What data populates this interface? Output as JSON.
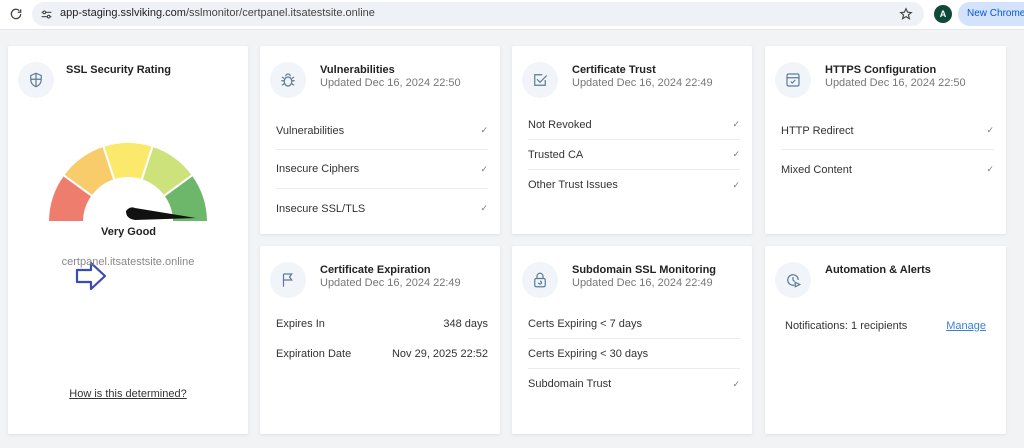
{
  "browser": {
    "url_host": "app-staging.sslviking.com",
    "url_path": "/sslmonitor/certpanel.itsatestsite.online",
    "avatar_initial": "A",
    "new_chrome_label": "New Chrome a"
  },
  "rating": {
    "title": "SSL Security Rating",
    "grade": "Very Good",
    "domain": "certpanel.itsatestsite.online",
    "how_link": "How is this determined?",
    "gauge_colors": [
      "#ef7d6d",
      "#f8cc6b",
      "#fbe96b",
      "#cde27a",
      "#6db76b"
    ],
    "arrow_color": "#3a4bb3"
  },
  "vulnerabilities": {
    "title": "Vulnerabilities",
    "updated": "Updated Dec 16, 2024 22:50",
    "rows": [
      {
        "label": "Vulnerabilities",
        "status": "✓"
      },
      {
        "label": "Insecure Ciphers",
        "status": "✓"
      },
      {
        "label": "Insecure SSL/TLS",
        "status": "✓"
      }
    ]
  },
  "trust": {
    "title": "Certificate Trust",
    "updated": "Updated Dec 16, 2024 22:49",
    "rows": [
      {
        "label": "Not Revoked",
        "status": "✓"
      },
      {
        "label": "Trusted CA",
        "status": "✓"
      },
      {
        "label": "Other Trust Issues",
        "status": "✓"
      }
    ]
  },
  "https": {
    "title": "HTTPS Configuration",
    "updated": "Updated Dec 16, 2024 22:50",
    "rows": [
      {
        "label": "HTTP Redirect",
        "status": "✓"
      },
      {
        "label": "Mixed Content",
        "status": "✓"
      }
    ]
  },
  "expiration": {
    "title": "Certificate Expiration",
    "updated": "Updated Dec 16, 2024 22:49",
    "rows": [
      {
        "label": "Expires In",
        "value": "348 days"
      },
      {
        "label": "Expiration Date",
        "value": "Nov 29, 2025 22:52"
      }
    ]
  },
  "subdomain": {
    "title": "Subdomain SSL Monitoring",
    "updated": "Updated Dec 16, 2024 22:49",
    "rows": [
      {
        "label": "Certs Expiring < 7 days",
        "status": ""
      },
      {
        "label": "Certs Expiring < 30 days",
        "status": ""
      },
      {
        "label": "Subdomain Trust",
        "status": "✓"
      }
    ]
  },
  "automation": {
    "title": "Automation & Alerts",
    "notifications": "Notifications: 1 recipients",
    "manage_label": "Manage"
  }
}
